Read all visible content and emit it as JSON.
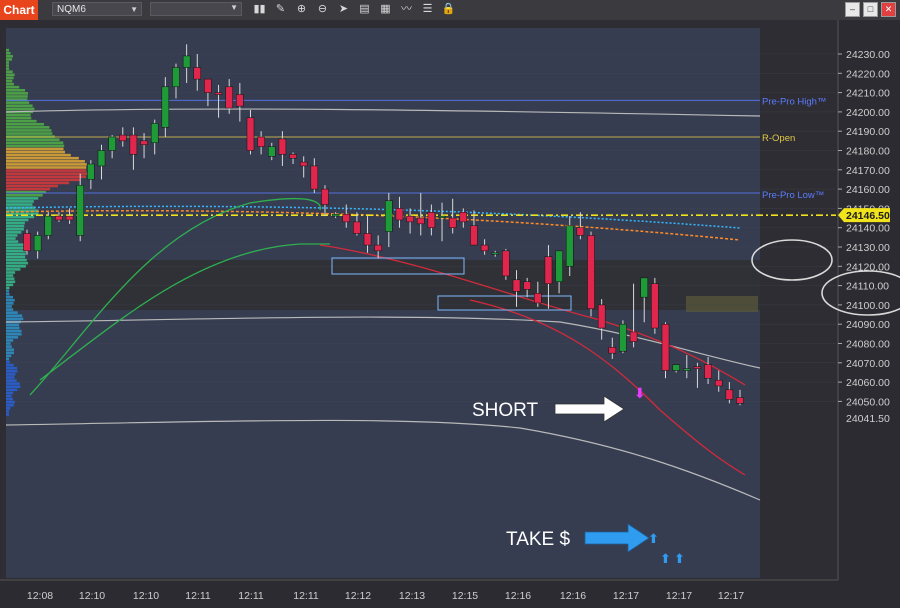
{
  "window": {
    "tab_label": "Chart",
    "symbol": "NQM6",
    "icon_chevron": "chevron-down-icon",
    "tools": [
      "bar-chart-icon",
      "pencil-icon",
      "zoom-in-icon",
      "zoom-out-icon",
      "cursor-icon",
      "document-icon",
      "grid-icon",
      "line-chart-icon",
      "properties-icon",
      "lock-icon"
    ],
    "window_buttons": [
      "minimize-icon",
      "restore-icon",
      "close-icon"
    ]
  },
  "chart_data": {
    "type": "candlestick",
    "instrument": "NQM6",
    "y_ticks": [
      24230,
      24220,
      24210,
      24200,
      24190,
      24180,
      24170,
      24160,
      24150,
      24140,
      24130,
      24120,
      24110,
      24100,
      24090,
      24080,
      24070,
      24060,
      24050
    ],
    "x_tick_labels": [
      "12:08",
      "12:10",
      "12:10",
      "12:11",
      "12:11",
      "12:11",
      "12:12",
      "12:13",
      "12:15",
      "12:16",
      "12:16",
      "12:17",
      "12:17",
      "12:17"
    ],
    "ylim": [
      24040,
      24237
    ],
    "current_price_label": "24146.50",
    "current_price": 24146.5,
    "partial_bottom_label": "24041.50",
    "levels": [
      {
        "name": "Pre-Pro High™",
        "value": 24206,
        "color": "#5b7bff"
      },
      {
        "name": "R-Open",
        "value": 24187,
        "color": "#e0c94a"
      },
      {
        "name": "Pre-Pro Low™",
        "value": 24158,
        "color": "#5b7bff"
      }
    ],
    "candles": [
      [
        24137,
        24139,
        24126,
        24128
      ],
      [
        24128,
        24138,
        24124,
        24136
      ],
      [
        24136,
        24148,
        24134,
        24146
      ],
      [
        24146,
        24148,
        24143,
        24144
      ],
      [
        24146,
        24150,
        24142,
        24144
      ],
      [
        24136,
        24168,
        24133,
        24162
      ],
      [
        24165,
        24175,
        24160,
        24173
      ],
      [
        24172,
        24183,
        24165,
        24180
      ],
      [
        24180,
        24188,
        24176,
        24187
      ],
      [
        24188,
        24192,
        24182,
        24185
      ],
      [
        24188,
        24192,
        24170,
        24178
      ],
      [
        24185,
        24189,
        24176,
        24183
      ],
      [
        24184,
        24196,
        24178,
        24194
      ],
      [
        24192,
        24218,
        24187,
        24213
      ],
      [
        24213,
        24225,
        24207,
        24223
      ],
      [
        24223,
        24235,
        24215,
        24229
      ],
      [
        24223,
        24230,
        24211,
        24217
      ],
      [
        24217,
        24213,
        24203,
        24210
      ],
      [
        24210,
        24214,
        24197,
        24209
      ],
      [
        24213,
        24217,
        24199,
        24202
      ],
      [
        24209,
        24215,
        24195,
        24203
      ],
      [
        24197,
        24201,
        24178,
        24180
      ],
      [
        24187,
        24190,
        24178,
        24182
      ],
      [
        24177,
        24184,
        24175,
        24182
      ],
      [
        24186,
        24190,
        24172,
        24178
      ],
      [
        24178,
        24179,
        24173,
        24176
      ],
      [
        24174,
        24177,
        24166,
        24172
      ],
      [
        24172,
        24176,
        24158,
        24160
      ],
      [
        24160,
        24162,
        24146,
        24152
      ],
      [
        24146,
        24148,
        24145,
        24147
      ],
      [
        24147,
        24152,
        24140,
        24143
      ],
      [
        24143,
        24148,
        24136,
        24137
      ],
      [
        24137,
        24146,
        24127,
        24131
      ],
      [
        24131,
        24136,
        24124,
        24128
      ],
      [
        24138,
        24158,
        24130,
        24154
      ],
      [
        24150,
        24156,
        24140,
        24144
      ],
      [
        24146,
        24150,
        24137,
        24143
      ],
      [
        24145,
        24158,
        24136,
        24142
      ],
      [
        24148,
        24152,
        24136,
        24140
      ],
      [
        24146,
        24153,
        24133,
        24146
      ],
      [
        24145,
        24155,
        24137,
        24140
      ],
      [
        24148,
        24150,
        24140,
        24143
      ],
      [
        24141,
        24149,
        24135,
        24131
      ],
      [
        24131,
        24134,
        24126,
        24128
      ],
      [
        24127,
        24128,
        24125,
        24127
      ],
      [
        24128,
        24129,
        24113,
        24115
      ],
      [
        24113,
        24118,
        24099,
        24107
      ],
      [
        24112,
        24114,
        24104,
        24108
      ],
      [
        24106,
        24112,
        24099,
        24101
      ],
      [
        24125,
        24131,
        24098,
        24111
      ],
      [
        24112,
        24127,
        24106,
        24128
      ],
      [
        24120,
        24146,
        24115,
        24141
      ],
      [
        24140,
        24148,
        24134,
        24136
      ],
      [
        24136,
        24138,
        24094,
        24098
      ],
      [
        24100,
        24103,
        24082,
        24088
      ],
      [
        24078,
        24083,
        24072,
        24075
      ],
      [
        24076,
        24092,
        24075,
        24090
      ],
      [
        24086,
        24111,
        24078,
        24081
      ],
      [
        24104,
        24114,
        24091,
        24114
      ],
      [
        24111,
        24114,
        24085,
        24088
      ],
      [
        24090,
        24091,
        24062,
        24066
      ],
      [
        24066,
        24068,
        24065,
        24069
      ],
      [
        24066,
        24074,
        24062,
        24067
      ],
      [
        24068,
        24070,
        24057,
        24067
      ],
      [
        24069,
        24073,
        24059,
        24062
      ],
      [
        24061,
        24066,
        24055,
        24058
      ],
      [
        24056,
        24060,
        24049,
        24051
      ],
      [
        24052,
        24056,
        24048,
        24049
      ]
    ],
    "annotations": [
      {
        "text": "SHORT",
        "color": "#ffffff",
        "arrow": "white"
      },
      {
        "text": "TAKE $",
        "color": "#ffffff",
        "arrow": "blue"
      }
    ]
  }
}
